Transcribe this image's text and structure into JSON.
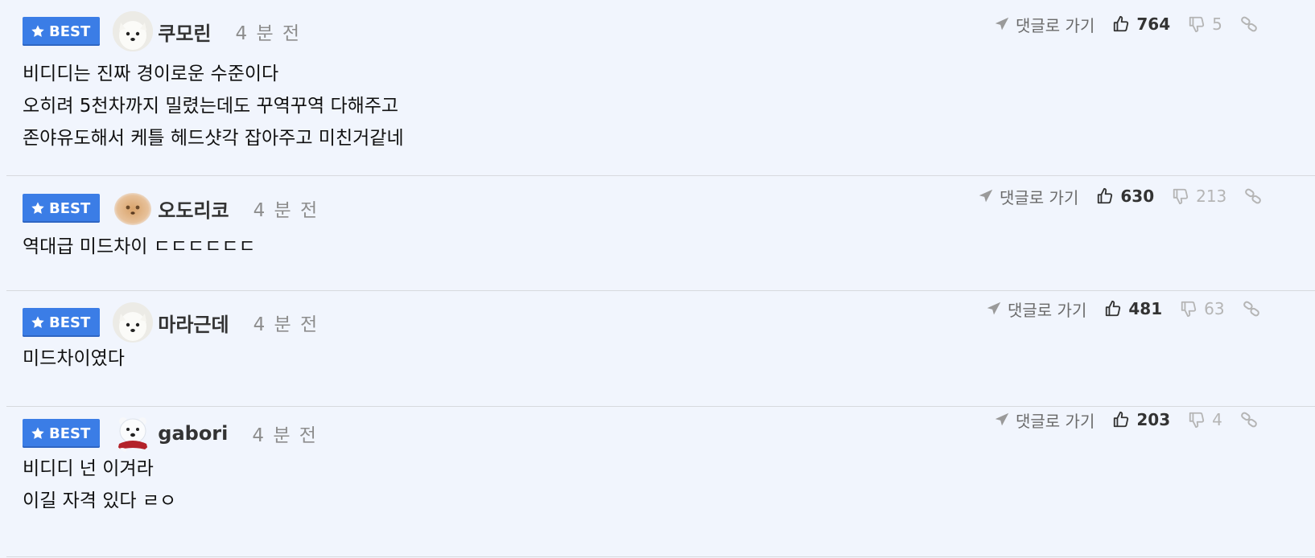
{
  "badge_label": "BEST",
  "reply_link_label": "댓글로 가기",
  "colors": {
    "background": "#f1f5fd",
    "badge": "#3b7de6",
    "divider": "#d7d9de",
    "muted": "#8d8d8d"
  },
  "comments": [
    {
      "nickname": "쿠모린",
      "time": "4 분 전",
      "avatar": "white-dog",
      "lines": [
        "비디디는 진짜 경이로운 수준이다",
        "오히려 5천차까지 밀렸는데도 꾸역꾸역 다해주고",
        "존야유도해서 케틀 헤드샷각 잡아주고 미친거같네"
      ],
      "likes": "764",
      "dislikes": "5"
    },
    {
      "nickname": "오도리코",
      "time": "4 분 전",
      "avatar": "tan-dog-blurred",
      "lines": [
        "역대급 미드차이 ㄷㄷㄷㄷㄷㄷ"
      ],
      "likes": "630",
      "dislikes": "213"
    },
    {
      "nickname": "마라근데",
      "time": "4 분 전",
      "avatar": "white-dog",
      "lines": [
        "미드차이였다"
      ],
      "likes": "481",
      "dislikes": "63"
    },
    {
      "nickname": "gabori",
      "time": "4 분 전",
      "avatar": "polar-bear",
      "lines": [
        "비디디 넌 이겨라",
        "이길 자격 있다 ㄹㅇ"
      ],
      "likes": "203",
      "dislikes": "4"
    }
  ]
}
